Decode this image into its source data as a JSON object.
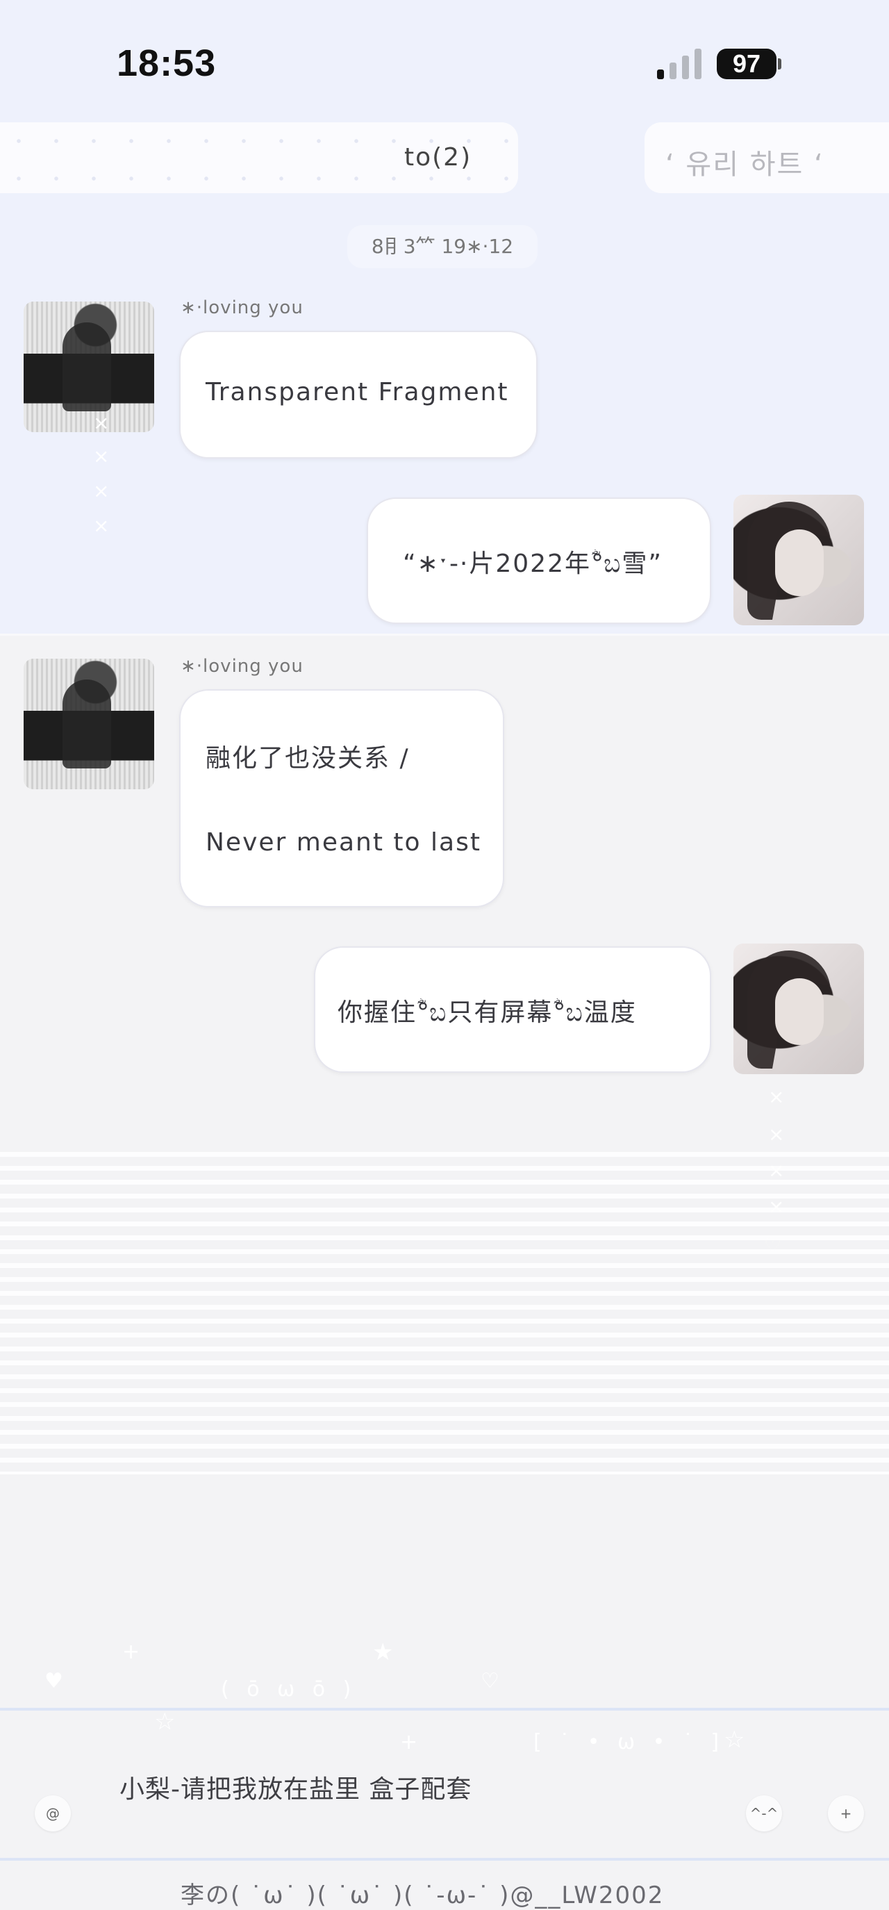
{
  "status_bar": {
    "time": "18:53",
    "battery": "97"
  },
  "header": {
    "left_title": "to(2)",
    "right_title": "‘ 유리 하트 ‘"
  },
  "timestamp": "8⺝3⺮ 19∗·12",
  "messages": [
    {
      "side": "left",
      "sender": "∗·loving you",
      "lines": [
        "Transparent Fragment"
      ]
    },
    {
      "side": "right",
      "lines": [
        "“∗ˑ-·片2022年ؓ°ಬ雪”"
      ]
    },
    {
      "side": "left",
      "sender": "∗·loving you",
      "lines": [
        "融化了也没关系 /",
        "Never meant to last"
      ]
    },
    {
      "side": "right",
      "lines": [
        "你握住ؓ°ಬ只有屏幕ؓ°ಬ温度"
      ]
    }
  ],
  "composer": {
    "text": "小梨-请把我放在盐里 盒子配套",
    "at_button": "@",
    "emoji_button": "^-^",
    "plus_button": "+",
    "kaomoji_left": "( ō ω ō )",
    "kaomoji_right": "[ ˙ • ω • ˙ ]"
  },
  "footer": {
    "signature": "李の( ˙ω˙ )( ˙ω˙ )( ˙-ω-˙ )@__LW2002"
  },
  "colors": {
    "top_bg": "#eef1fc",
    "bottom_bg": "#f3f3f5",
    "bubble": "#ffffff"
  }
}
